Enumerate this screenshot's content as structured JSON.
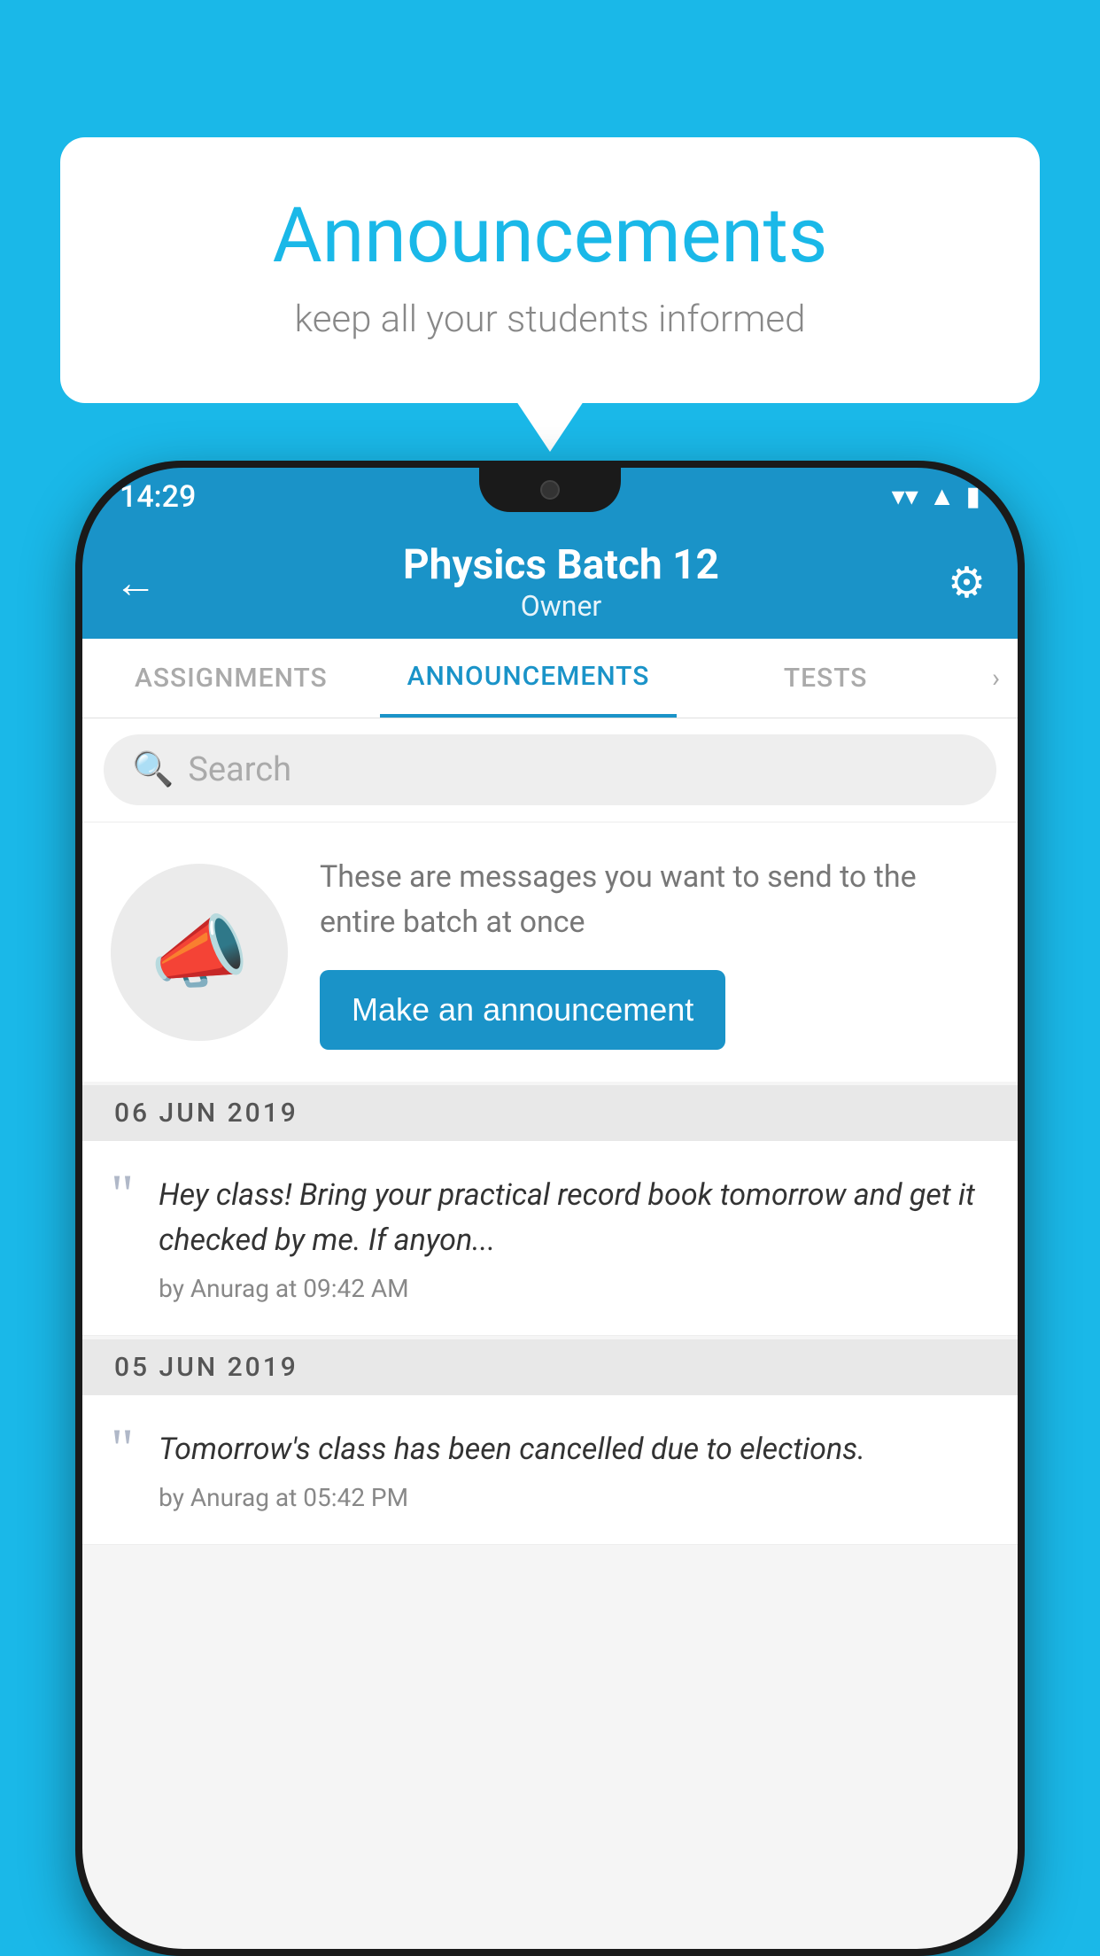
{
  "bubble": {
    "title": "Announcements",
    "subtitle": "keep all your students informed"
  },
  "phone": {
    "status_bar": {
      "time": "14:29"
    },
    "app_bar": {
      "title": "Physics Batch 12",
      "subtitle": "Owner",
      "back_label": "←",
      "settings_label": "⚙"
    },
    "tabs": [
      {
        "label": "ASSIGNMENTS",
        "active": false
      },
      {
        "label": "ANNOUNCEMENTS",
        "active": true
      },
      {
        "label": "TESTS",
        "active": false
      }
    ],
    "tabs_more": ">",
    "search": {
      "placeholder": "Search"
    },
    "promo": {
      "description": "These are messages you want to send to the entire batch at once",
      "button_label": "Make an announcement"
    },
    "announcements": [
      {
        "date": "06  JUN  2019",
        "body": "Hey class! Bring your practical record book tomorrow and get it checked by me. If anyon...",
        "meta": "by Anurag at 09:42 AM"
      },
      {
        "date": "05  JUN  2019",
        "body": "Tomorrow's class has been cancelled due to elections.",
        "meta": "by Anurag at 05:42 PM"
      }
    ]
  },
  "colors": {
    "primary": "#1a93c8",
    "background": "#1ab8e8",
    "white": "#ffffff"
  }
}
